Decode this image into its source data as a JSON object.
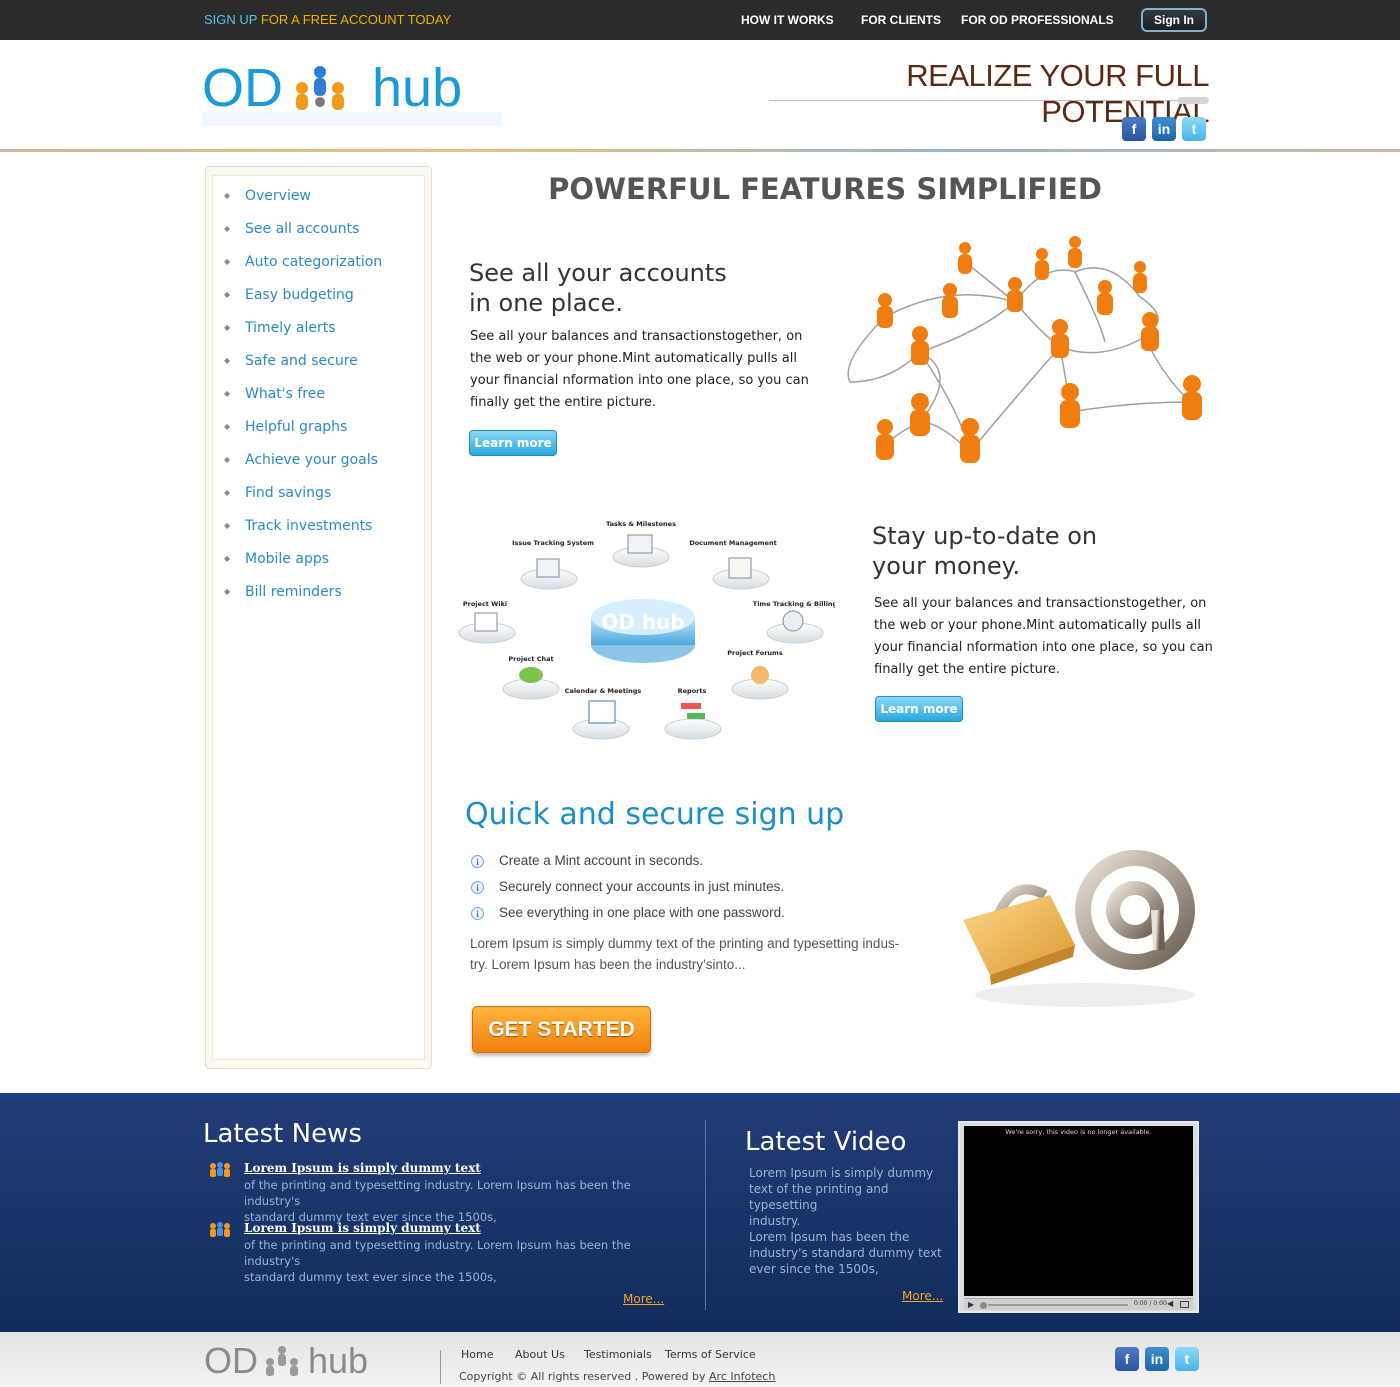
{
  "topbar": {
    "signup_prefix": "SIGN UP",
    "signup_rest": " FOR A FREE ACCOUNT TODAY",
    "nav": [
      "HOW IT WORKS",
      "FOR CLIENTS",
      "FOR OD PROFESSIONALS"
    ],
    "signin_label": "Sign In"
  },
  "header": {
    "logo_text_left": "OD",
    "logo_text_right": "hub",
    "tagline": "REALIZE YOUR FULL POTENTIAL",
    "social": [
      {
        "icon": "facebook-icon",
        "glyph": "f"
      },
      {
        "icon": "linkedin-icon",
        "glyph": "in"
      },
      {
        "icon": "twitter-icon",
        "glyph": "t"
      }
    ]
  },
  "sidebar": {
    "items": [
      "Overview",
      "See all accounts",
      "Auto categorization",
      "Easy budgeting",
      "Timely alerts",
      "Safe and secure",
      "What's free",
      "Helpful graphs",
      "Achieve your goals",
      "Find savings",
      "Track investments",
      "Mobile apps",
      "Bill reminders"
    ]
  },
  "main": {
    "title": "POWERFUL FEATURES SIMPLIFIED",
    "feature1": {
      "heading_line1": "See all your accounts",
      "heading_line2": "in one place.",
      "body_lines": [
        "See all your balances and transactionstogether, on",
        "the web or your phone.Mint automatically pulls all",
        "your financial nformation into one place, so you can",
        "finally get the entire picture."
      ],
      "button": "Learn more"
    },
    "feature2": {
      "heading_line1": "Stay up-to-date on",
      "heading_line2": "your money.",
      "body_lines": [
        "See all your balances and transactionstogether, on",
        "the web or your phone.Mint automatically pulls all",
        "your financial nformation into one place, so you can",
        "finally get the entire picture."
      ],
      "button": "Learn more",
      "diagram": {
        "center": "OD hub",
        "nodes": [
          "Tasks & Milestones",
          "Issue Tracking System",
          "Document Management",
          "Project Wiki",
          "Time Tracking & Billing",
          "Project Chat",
          "Project Forums",
          "Calendar & Meetings",
          "Reports"
        ]
      }
    },
    "signup": {
      "title": "Quick and secure sign up",
      "items": [
        "Create a Mint account in seconds.",
        "Securely connect your accounts in just minutes.",
        "See everything in one place with one password."
      ],
      "desc_line1": "Lorem Ipsum is simply dummy text of the printing and typesetting indus-",
      "desc_line2": "try. Lorem Ipsum has been the industry'sinto...",
      "cta": "GET STARTED"
    }
  },
  "footer": {
    "news_title": "Latest News",
    "news": [
      {
        "title": "Lorem Ipsum is simply dummy text",
        "line1": "of the printing and typesetting industry. Lorem Ipsum has been the industry's",
        "line2": "standard dummy text ever since the 1500s,"
      },
      {
        "title": "Lorem Ipsum is simply dummy text",
        "line1": "of the printing and typesetting industry. Lorem Ipsum has been the industry's",
        "line2": "standard dummy text ever since the 1500s,"
      }
    ],
    "news_more": "More...",
    "video_title": "Latest Video",
    "video_p1": [
      "Lorem Ipsum is simply dummy",
      "text of the printing and typesetting",
      "industry."
    ],
    "video_p2": [
      "Lorem Ipsum has been the",
      "industry's standard dummy text",
      "ever since the 1500s,"
    ],
    "video_more": "More...",
    "video_message": "We're sorry, this video is no longer available.",
    "video_time": "0:00 / 0:00"
  },
  "bottom": {
    "links": [
      "Home",
      "About Us",
      "Testimonials",
      "Terms of Service"
    ],
    "copyright": "Copyright ©  All rights reserved . Powered by ",
    "powered_by": "Arc Infotech"
  },
  "colors": {
    "accent_blue": "#2a8bbf",
    "orange": "#f0800e",
    "footer_navy": "#163467"
  }
}
